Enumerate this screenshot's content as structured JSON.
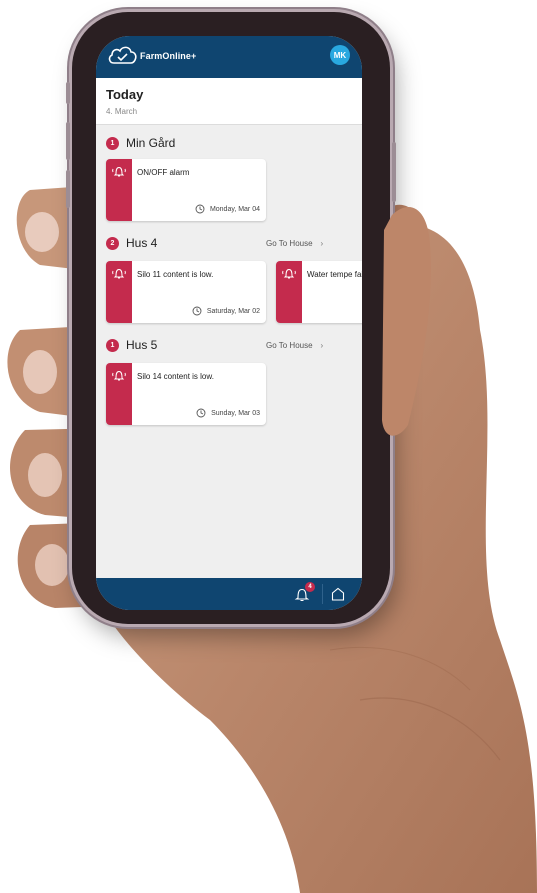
{
  "app": {
    "brand": "FarmOnline+",
    "user_initials": "MK"
  },
  "header": {
    "title": "Today",
    "date": "4. March"
  },
  "sections": [
    {
      "count": "1",
      "name": "Min Gård",
      "goto_label": "",
      "alerts": [
        {
          "message": "ON/OFF alarm",
          "time": "Monday, Mar 04"
        }
      ]
    },
    {
      "count": "2",
      "name": "Hus 4",
      "goto_label": "Go To House",
      "alerts": [
        {
          "message": "Silo 11 content is low.",
          "time": "Saturday, Mar 02"
        },
        {
          "message": "Water tempe failure",
          "time": ""
        }
      ]
    },
    {
      "count": "1",
      "name": "Hus 5",
      "goto_label": "Go To House",
      "alerts": [
        {
          "message": "Silo 14 content is low.",
          "time": "Sunday, Mar 03"
        }
      ]
    }
  ],
  "bottom_nav": {
    "notification_count": "4",
    "icons": [
      "bell-icon",
      "house-icon"
    ]
  },
  "colors": {
    "primary": "#0f4570",
    "alert": "#c42b4d",
    "avatar": "#29a8e0",
    "background": "#efefef"
  }
}
